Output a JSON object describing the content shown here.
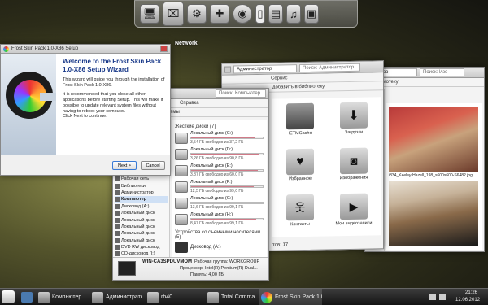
{
  "dock": {
    "label": "Network",
    "icons": [
      "monitor-icon",
      "network-icon",
      "control-panel-icon",
      "gamepad-icon",
      "media-player-icon",
      "notes-icon",
      "documents-icon",
      "music-icon",
      "pictures-icon"
    ]
  },
  "setup": {
    "title": "Frost Skin Pack 1.0-X86 Setup",
    "heading": "Welcome to the Frost Skin Pack 1.0-X86 Setup Wizard",
    "p1": "This wizard will guide you through the installation of Frost Skin Pack 1.0-X86.",
    "p2": "It is recommended that you close all other applications before starting Setup. This will make it possible to update relevant system files without having to reboot your computer.",
    "p3": "Click Next to continue.",
    "next": "Next >",
    "cancel": "Cancel"
  },
  "explorer_right": {
    "address": "Изо",
    "search": "Поиск: Изо",
    "toolbar": "в библиотеку",
    "images": [
      {
        "caption": "i834_Keeley-Hazell_198_s600x600-S6482.jpg"
      },
      {
        "caption": ""
      }
    ]
  },
  "explorer_mid": {
    "address": "Администратор",
    "search": "Поиск: Администратор",
    "menu": "Сервис",
    "toolbar": "добавить в библиотеку",
    "items": [
      {
        "label": "IETMCache",
        "icon": "folder-icon"
      },
      {
        "label": "Загрузки",
        "icon": "downloads-icon"
      },
      {
        "label": "Избранное",
        "icon": "favorites-icon"
      },
      {
        "label": "Изображения",
        "icon": "camera-icon"
      },
      {
        "label": "Контакты",
        "icon": "contacts-icon"
      },
      {
        "label": "Мои видеозаписи",
        "icon": "video-icon"
      }
    ],
    "status": "тов: 17"
  },
  "explorer_front": {
    "search": "Поиск: Компьютер",
    "menu": "Справка",
    "toolbar": "Свойства системы",
    "drives_header": "Жесткие диски (7)",
    "drives": [
      {
        "name": "Локальный диск (C:)",
        "free": "3,54 ГБ свободно из 37,2 ГБ",
        "fill": 0.9
      },
      {
        "name": "Локальный диск (D:)",
        "free": "3,26 ГБ свободно из 90,8 ГБ",
        "fill": 0.96
      },
      {
        "name": "Локальный диск (E:)",
        "free": "3,87 ГБ свободно из 60,0 ГБ",
        "fill": 0.93
      },
      {
        "name": "Локальный диск (F:)",
        "free": "12,5 ГБ свободно из 99,0 ГБ",
        "fill": 0.87
      },
      {
        "name": "Локальный диск (G:)",
        "free": "13,6 ГБ свободно из 99,1 ГБ",
        "fill": 0.86
      },
      {
        "name": "Локальный диск (H:)",
        "free": "8,47 ГБ свободно из 99,1 ГБ",
        "fill": 0.91
      }
    ],
    "removable_header": "Устройства со съемными носителями (5)",
    "removable": [
      {
        "name": "Дисковод (A:)"
      }
    ],
    "sidebar": [
      {
        "label": "Рабочая сеть",
        "icon": "network-icon"
      },
      {
        "label": "Библиотеки",
        "icon": "library-icon"
      },
      {
        "label": "Администратор",
        "icon": "user-icon"
      },
      {
        "label": "Компьютер",
        "icon": "computer-icon"
      },
      {
        "label": "Дисковод (A:)",
        "icon": "floppy-icon"
      },
      {
        "label": "Локальный диск",
        "icon": "drive-icon"
      },
      {
        "label": "Локальный диск",
        "icon": "drive-icon"
      },
      {
        "label": "Локальный диск",
        "icon": "drive-icon"
      },
      {
        "label": "Локальный диск",
        "icon": "drive-icon"
      },
      {
        "label": "Локальный диск",
        "icon": "drive-icon"
      },
      {
        "label": "DVD RW дисковод",
        "icon": "dvd-icon"
      },
      {
        "label": "CD-дисковод (I:)",
        "icon": "cd-icon"
      }
    ],
    "details": {
      "name": "WIN-CA3SPDUVMOM",
      "workgroup": "Рабочая группа: WORKGROUP",
      "cpu": "Процессор: Intel(R) Pentium(R) Dual...",
      "memory": "Память: 4,00 ГБ"
    }
  },
  "taskbar": {
    "items": [
      {
        "label": "Компьютер",
        "icon": "computer-icon"
      },
      {
        "label": "Администратор",
        "icon": "folder-icon"
      },
      {
        "label": "rb40",
        "icon": "folder-icon"
      },
      {
        "label": "Total Commander ...",
        "icon": "total-commander-icon"
      },
      {
        "label": "Frost Skin Pack 1.0...",
        "icon": "setup-icon"
      }
    ],
    "time": "21:26",
    "date": "12.06.2012"
  },
  "colors": {
    "accent": "#d07a88",
    "setup_heading": "#1a3a8a"
  }
}
